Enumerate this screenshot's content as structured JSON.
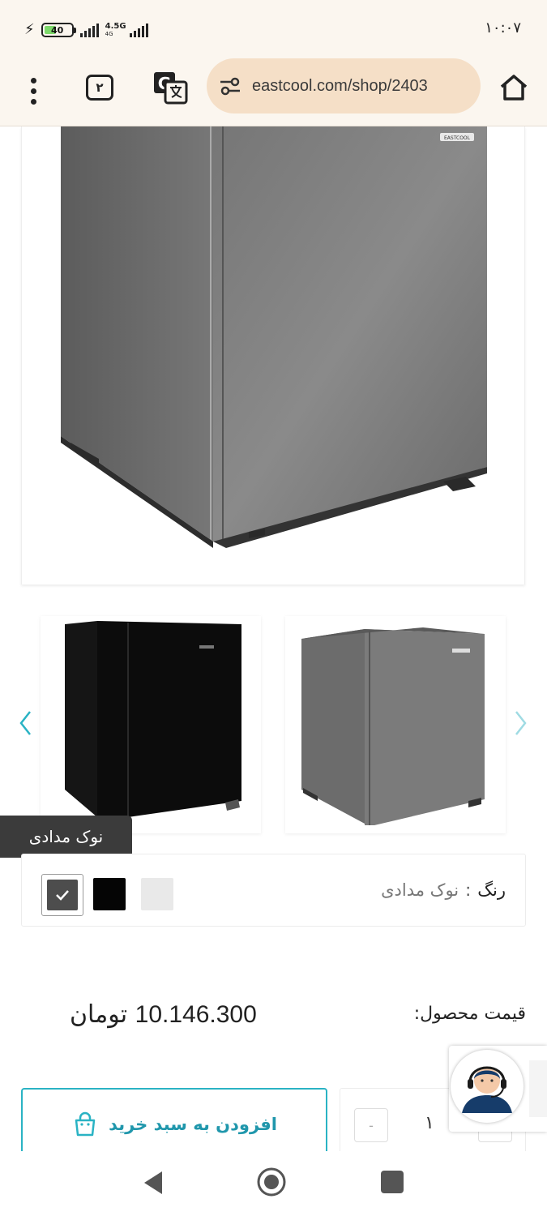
{
  "status_bar": {
    "battery_level": "40",
    "network_type": "4.5G",
    "network_sub": "4G",
    "time": "۱۰:۰۷"
  },
  "browser": {
    "tabs_count": "۲",
    "url": "eastcool.com/shop/2403"
  },
  "product": {
    "main_image_alt": "refrigerator-main-image",
    "brand_badge": "EASTCOOL",
    "thumbnails": [
      "black-refrigerator",
      "gray-refrigerator"
    ],
    "color": {
      "label": "رنگ",
      "separator": ":",
      "selected": "نوک مدادی",
      "tooltip": "نوک مدادی",
      "swatches": [
        {
          "name": "نوک مدادی",
          "hex": "#4d4d4d",
          "selected": true
        },
        {
          "name": "black",
          "hex": "#050505",
          "selected": false
        },
        {
          "name": "white",
          "hex": "#e9e9e9",
          "selected": false
        }
      ]
    },
    "price_label": "قیمت محصول:",
    "price_value": "10.146.300",
    "price_currency": "تومان",
    "add_to_cart": "افزودن به سبد خرید",
    "quantity": "۱",
    "quantity_minus": "-"
  },
  "colors": {
    "accent": "#2ab3c4",
    "browser_bar": "#fbf6ef",
    "url_pill": "#f5dfc7"
  }
}
